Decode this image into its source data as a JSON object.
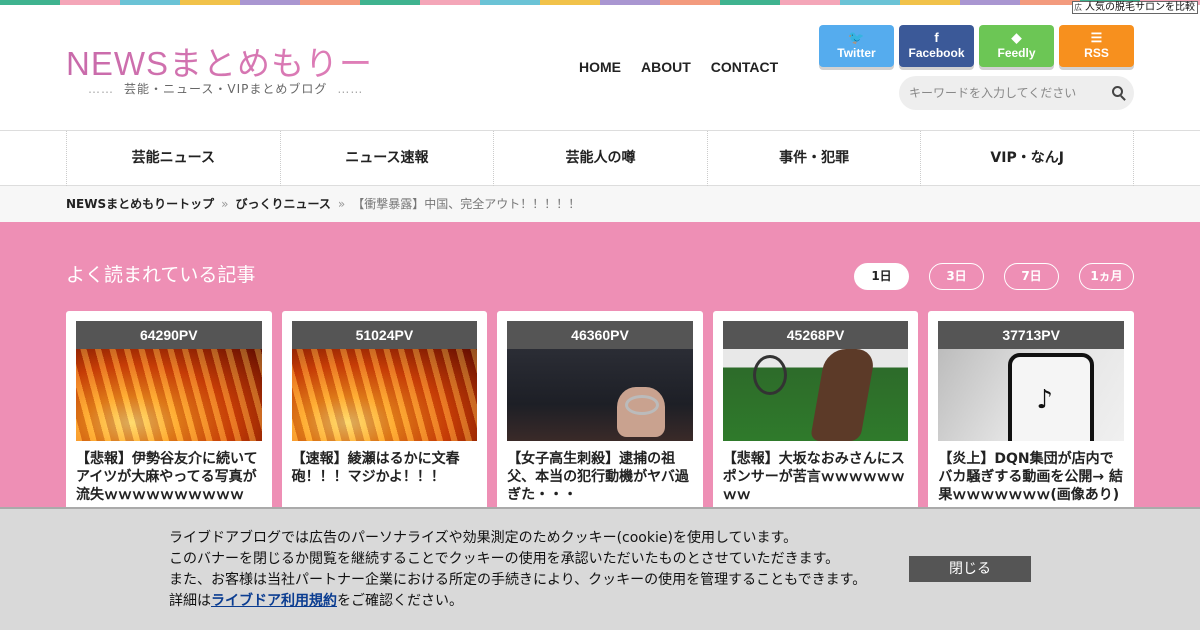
{
  "stripe_colors": [
    "#3fb38f",
    "#f4a6b8",
    "#6bc3d6",
    "#f1c24a",
    "#a996d1",
    "#f39b7e",
    "#3fb38f",
    "#f4a6b8",
    "#6bc3d6",
    "#f1c24a",
    "#a996d1",
    "#f39b7e",
    "#3fb38f",
    "#f4a6b8",
    "#6bc3d6",
    "#f1c24a",
    "#a996d1",
    "#f39b7e",
    "#3fb38f",
    "#f4a6b8"
  ],
  "ad_badge": "人気の脱毛サロンを比較",
  "header": {
    "logo": "NEWSまとめもりー",
    "tagline": "芸能・ニュース・VIPまとめブログ",
    "tagline_dots": "……"
  },
  "topnav": [
    "HOME",
    "ABOUT",
    "CONTACT"
  ],
  "social": [
    {
      "label": "Twitter",
      "icon": "twitter-icon",
      "glyph": "🐦",
      "color": "#55acee"
    },
    {
      "label": "Facebook",
      "icon": "facebook-icon",
      "glyph": "f",
      "color": "#3b5998"
    },
    {
      "label": "Feedly",
      "icon": "feedly-icon",
      "glyph": "◆",
      "color": "#6cc655"
    },
    {
      "label": "RSS",
      "icon": "rss-icon",
      "glyph": "☰",
      "color": "#f7901e"
    }
  ],
  "search": {
    "placeholder": "キーワードを入力してください"
  },
  "categories": [
    "芸能ニュース",
    "ニュース速報",
    "芸能人の噂",
    "事件・犯罪",
    "VIP・なんJ"
  ],
  "breadcrumbs": {
    "home": "NEWSまとめもりートップ",
    "section": "びっくりニュース",
    "sep": "»",
    "current": "【衝撃暴露】中国、完全アウト！！！！！"
  },
  "popular": {
    "title": "よく読まれている記事",
    "periods": [
      {
        "label": "1日",
        "active": true
      },
      {
        "label": "3日",
        "active": false
      },
      {
        "label": "7日",
        "active": false
      },
      {
        "label": "1ヵ月",
        "active": false
      }
    ],
    "cards": [
      {
        "pv": "64290PV",
        "thumb": "fire",
        "title": "【悲報】伊勢谷友介に続いてアイツが大麻やってる写真が流失ｗｗｗｗｗｗｗｗｗｗ"
      },
      {
        "pv": "51024PV",
        "thumb": "fire",
        "title": "【速報】綾瀬はるかに文春砲！！！マジかよ！！！"
      },
      {
        "pv": "46360PV",
        "thumb": "cuff",
        "title": "【女子高生刺殺】逮捕の祖父、本当の犯行動機がヤバ過ぎた・・・"
      },
      {
        "pv": "45268PV",
        "thumb": "tennis",
        "title": "【悲報】大坂なおみさんにスポンサーが苦言ｗｗｗｗｗｗｗｗ"
      },
      {
        "pv": "37713PV",
        "thumb": "tiktok",
        "title": "【炎上】DQN集団が店内でバカ騒ぎする動画を公開→ 結果ｗｗｗｗｗｗｗ(画像あり)"
      }
    ]
  },
  "cookie": {
    "line1": "ライブドアブログでは広告のパーソナライズや効果測定のためクッキー(cookie)を使用しています。",
    "line2": "このバナーを閉じるか閲覧を継続することでクッキーの使用を承認いただいたものとさせていただきます。",
    "line3": "また、お客様は当社パートナー企業における所定の手続きにより、クッキーの使用を管理することもできます。",
    "line4_prefix": "詳細は",
    "line4_link": "ライブドア利用規約",
    "line4_suffix": "をご確認ください。",
    "close": "閉じる"
  }
}
